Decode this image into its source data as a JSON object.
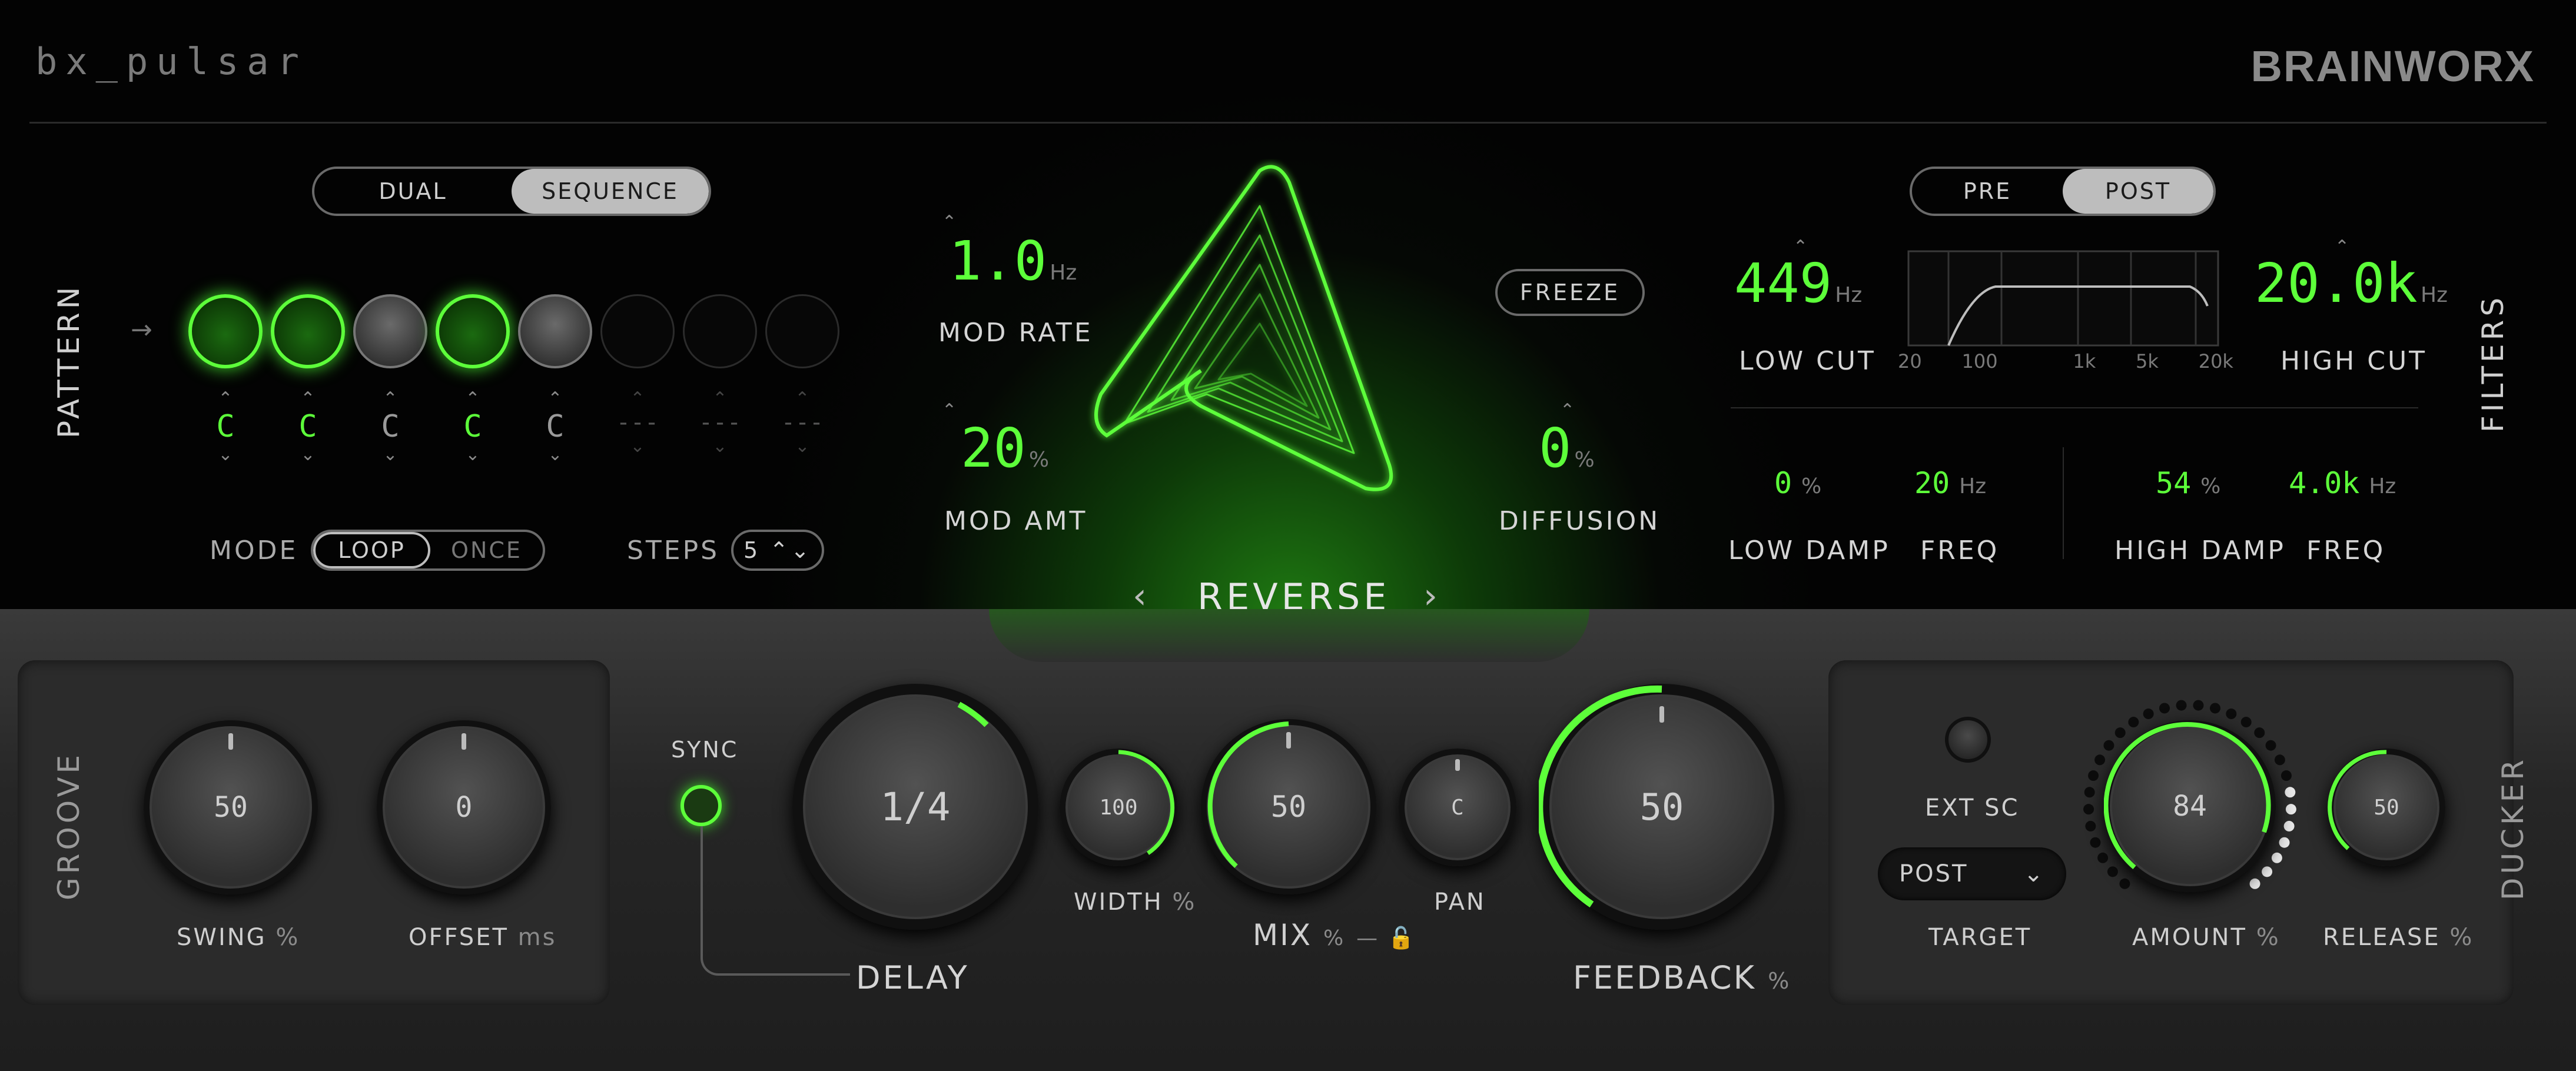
{
  "header": {
    "brand": "bx_pulsar",
    "logo": "BRAINWORX"
  },
  "colors": {
    "accent": "#5dff3a",
    "bg_top": "#030303",
    "bg_bottom": "#262626"
  },
  "pattern": {
    "section_label": "PATTERN",
    "mode_toggle": {
      "options": [
        "DUAL",
        "SEQUENCE"
      ],
      "selected": "SEQUENCE"
    },
    "steps": [
      {
        "value": "C",
        "state": "active"
      },
      {
        "value": "C",
        "state": "active"
      },
      {
        "value": "C",
        "state": "inactive"
      },
      {
        "value": "C",
        "state": "active"
      },
      {
        "value": "C",
        "state": "inactive"
      },
      {
        "value": "---",
        "state": "empty"
      },
      {
        "value": "---",
        "state": "empty"
      },
      {
        "value": "---",
        "state": "empty"
      }
    ],
    "mode_label": "MODE",
    "mode_options": [
      "LOOP",
      "ONCE"
    ],
    "mode_selected": "LOOP",
    "steps_label": "STEPS",
    "steps_value": "5 ⌃⌄"
  },
  "center": {
    "mod_rate": {
      "value": "1.0",
      "unit": "Hz",
      "label": "MOD RATE"
    },
    "mod_amt": {
      "value": "20",
      "unit": "%",
      "label": "MOD AMT"
    },
    "freeze": "FREEZE",
    "diffusion": {
      "value": "0",
      "unit": "%",
      "label": "DIFFUSION"
    },
    "algorithm": "REVERSE",
    "prev": "‹",
    "next": "›"
  },
  "filters": {
    "section_label": "FILTERS",
    "position": {
      "options": [
        "PRE",
        "POST"
      ],
      "selected": "POST"
    },
    "low_cut": {
      "value": "449",
      "unit": "Hz",
      "label": "LOW CUT"
    },
    "high_cut": {
      "value": "20.0k",
      "unit": "Hz",
      "label": "HIGH CUT"
    },
    "graph_ticks": [
      "20",
      "100",
      "1k",
      "5k",
      "20k"
    ],
    "low_damp": {
      "value": "0",
      "unit": "%",
      "label": "LOW DAMP"
    },
    "low_freq": {
      "value": "20",
      "unit": "Hz",
      "label": "FREQ"
    },
    "high_damp": {
      "value": "54",
      "unit": "%",
      "label": "HIGH DAMP"
    },
    "high_freq": {
      "value": "4.0k",
      "unit": "Hz",
      "label": "FREQ"
    }
  },
  "groove": {
    "section_label": "GROOVE",
    "swing": {
      "value": "50",
      "label": "SWING",
      "unit": "%"
    },
    "offset": {
      "value": "0",
      "label": "OFFSET",
      "unit": "ms"
    }
  },
  "main": {
    "sync_label": "SYNC",
    "delay": {
      "value": "1/4",
      "label": "DELAY"
    },
    "width": {
      "value": "100",
      "label": "WIDTH",
      "unit": "%"
    },
    "mix": {
      "value": "50",
      "label": "MIX",
      "unit": "%",
      "extra": "— 🔓"
    },
    "pan": {
      "value": "C",
      "label": "PAN"
    },
    "feedback": {
      "value": "50",
      "label": "FEEDBACK",
      "unit": "%",
      "level": 0.5
    }
  },
  "ducker": {
    "section_label": "DUCKER",
    "ext_sc": "EXT SC",
    "target_value": "POST",
    "target_label": "TARGET",
    "amount": {
      "value": "84",
      "label": "AMOUNT",
      "unit": "%"
    },
    "release": {
      "value": "50",
      "label": "RELEASE",
      "unit": "%"
    }
  }
}
